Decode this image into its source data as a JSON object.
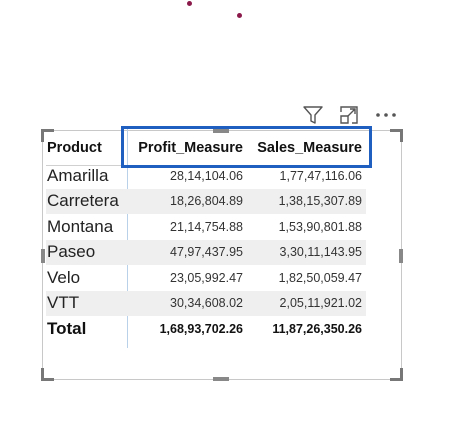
{
  "toolbar": {
    "filter_icon": "filter-icon",
    "focus_icon": "focus-mode-icon",
    "more_icon": "more-options-icon"
  },
  "table": {
    "columns": [
      "Product",
      "Profit_Measure",
      "Sales_Measure"
    ],
    "rows": [
      {
        "product": "Amarilla",
        "profit": "28,14,104.06",
        "sales": "1,77,47,116.06"
      },
      {
        "product": "Carretera",
        "profit": "18,26,804.89",
        "sales": "1,38,15,307.89"
      },
      {
        "product": "Montana",
        "profit": "21,14,754.88",
        "sales": "1,53,90,801.88"
      },
      {
        "product": "Paseo",
        "profit": "47,97,437.95",
        "sales": "3,30,11,143.95"
      },
      {
        "product": "Velo",
        "profit": "23,05,992.47",
        "sales": "1,82,50,059.47"
      },
      {
        "product": "VTT",
        "profit": "30,34,608.02",
        "sales": "2,05,11,921.02"
      }
    ],
    "total": {
      "label": "Total",
      "profit": "1,68,93,702.26",
      "sales": "11,87,26,350.26"
    }
  },
  "colors": {
    "highlight_border": "#1f5fbf",
    "row_shade": "#efefef",
    "column_divider": "#b9d2ea"
  }
}
